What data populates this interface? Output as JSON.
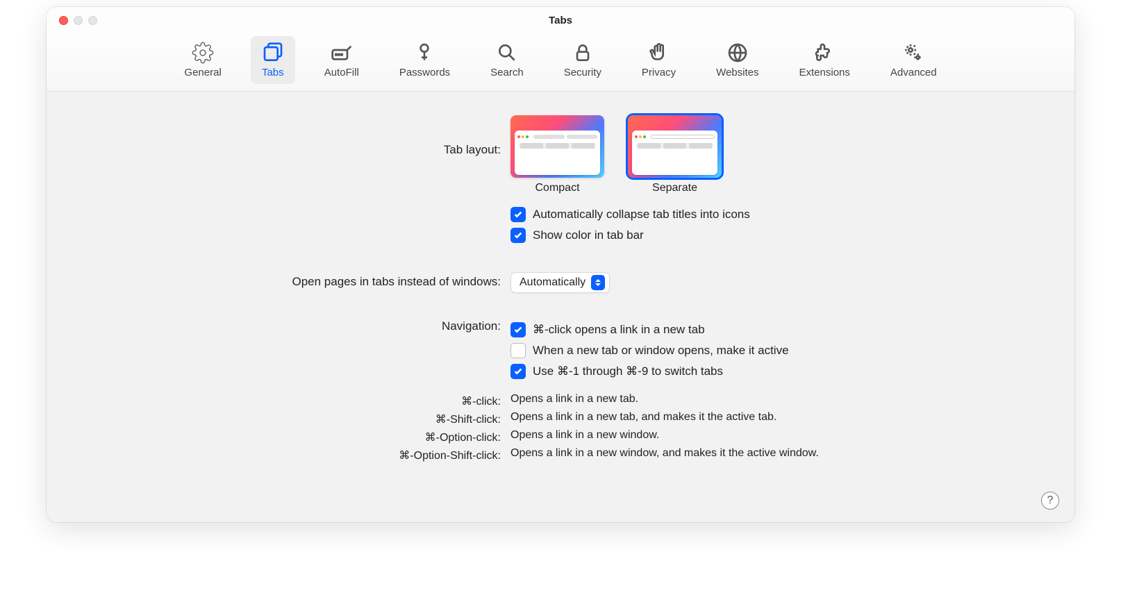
{
  "window": {
    "title": "Tabs"
  },
  "toolbar": {
    "items": [
      {
        "label": "General"
      },
      {
        "label": "Tabs"
      },
      {
        "label": "AutoFill"
      },
      {
        "label": "Passwords"
      },
      {
        "label": "Search"
      },
      {
        "label": "Security"
      },
      {
        "label": "Privacy"
      },
      {
        "label": "Websites"
      },
      {
        "label": "Extensions"
      },
      {
        "label": "Advanced"
      }
    ],
    "selected_index": 1
  },
  "tab_layout": {
    "label": "Tab layout:",
    "options": [
      {
        "label": "Compact"
      },
      {
        "label": "Separate"
      }
    ],
    "selected_index": 1,
    "checkboxes": [
      {
        "label": "Automatically collapse tab titles into icons",
        "checked": true
      },
      {
        "label": "Show color in tab bar",
        "checked": true
      }
    ]
  },
  "open_pages": {
    "label": "Open pages in tabs instead of windows:",
    "value": "Automatically"
  },
  "navigation": {
    "label": "Navigation:",
    "checkboxes": [
      {
        "label": "⌘-click opens a link in a new tab",
        "checked": true
      },
      {
        "label": "When a new tab or window opens, make it active",
        "checked": false
      },
      {
        "label": "Use ⌘-1 through ⌘-9 to switch tabs",
        "checked": true
      }
    ]
  },
  "hints": [
    {
      "key": "⌘-click:",
      "desc": "Opens a link in a new tab."
    },
    {
      "key": "⌘-Shift-click:",
      "desc": "Opens a link in a new tab, and makes it the active tab."
    },
    {
      "key": "⌘-Option-click:",
      "desc": "Opens a link in a new window."
    },
    {
      "key": "⌘-Option-Shift-click:",
      "desc": "Opens a link in a new window, and makes it the active window."
    }
  ],
  "help": "?"
}
